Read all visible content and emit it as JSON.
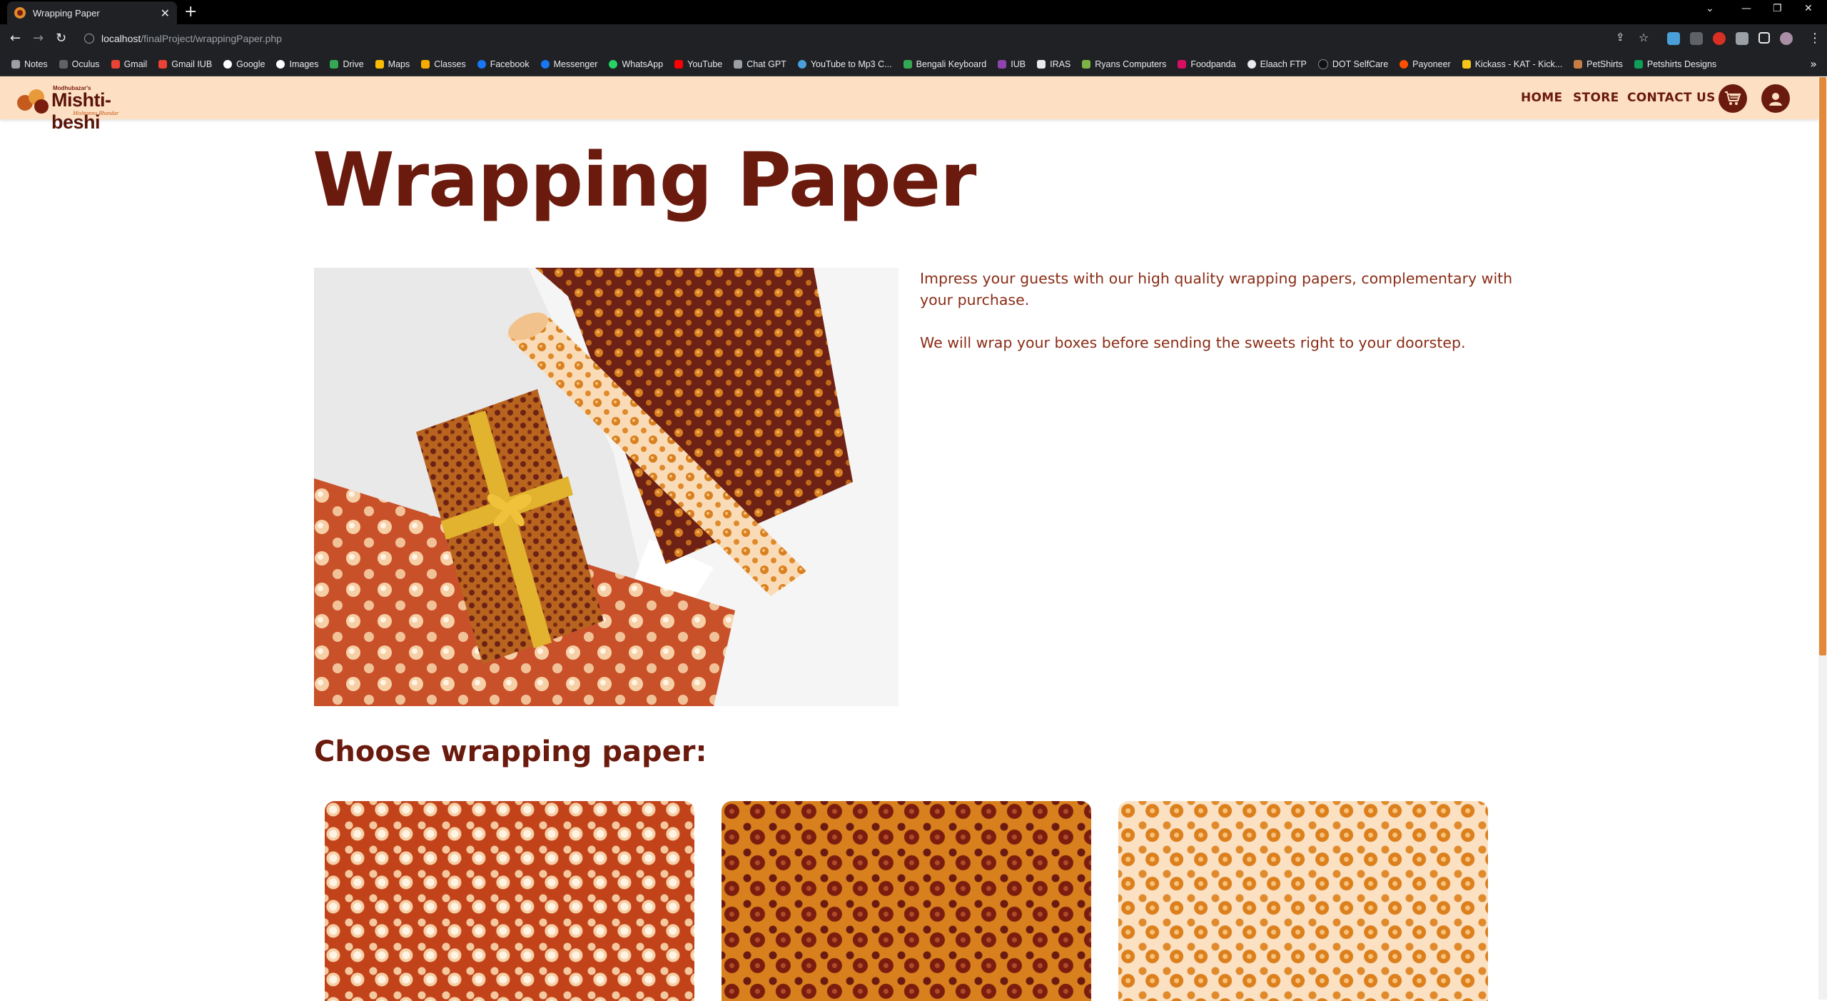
{
  "browser": {
    "tab_title": "Wrapping Paper",
    "url_host": "localhost",
    "url_path": "/finalProject/wrappingPaper.php",
    "bookmarks": [
      "Notes",
      "Oculus",
      "Gmail",
      "Gmail IUB",
      "Google",
      "Images",
      "Drive",
      "Maps",
      "Classes",
      "Facebook",
      "Messenger",
      "WhatsApp",
      "YouTube",
      "Chat GPT",
      "YouTube to Mp3 C...",
      "Bengali Keyboard",
      "IUB",
      "IRAS",
      "Ryans Computers",
      "Foodpanda",
      "Elaach FTP",
      "DOT SelfCare",
      "Payoneer",
      "Kickass - KAT - Kick...",
      "PetShirts",
      "Petshirts Designs"
    ]
  },
  "header": {
    "logo_tagline": "Modhubazar's",
    "logo_name": "Mishti-beshi",
    "logo_sub": "Mishtanno Bhandar",
    "nav": [
      "HOME",
      "STORE",
      "CONTACT US"
    ],
    "cart_icon": "cart-icon",
    "account_icon": "user-icon"
  },
  "main": {
    "title": "Wrapping Paper",
    "description": [
      "Impress your guests with our high quality wrapping papers, complementary with your purchase.",
      "We will wrap your boxes before sending the sweets right to your doorstep."
    ],
    "choose_title": "Choose wrapping paper:",
    "papers": [
      {
        "color": "#c2431a",
        "dots": "#f4c9a0"
      },
      {
        "color": "#d8801e",
        "dots": "#7a1d0e"
      },
      {
        "color": "#fbe1c2",
        "dots": "#dc7f1d"
      }
    ]
  },
  "colors": {
    "brand_dark": "#6b1a0e",
    "header_bg": "#fde0c4",
    "accent": "#e28a3a"
  }
}
